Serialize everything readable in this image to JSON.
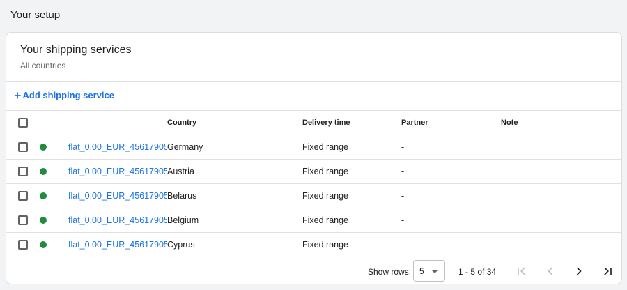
{
  "section": {
    "title": "Your setup"
  },
  "card": {
    "title": "Your shipping services",
    "subtitle": "All countries"
  },
  "actions": {
    "add_label": "Add shipping service",
    "add_icon": "plus-icon"
  },
  "table": {
    "columns": {
      "country": "Country",
      "delivery": "Delivery time",
      "partner": "Partner",
      "note": "Note"
    },
    "rows": [
      {
        "name": "flat_0.00_EUR_45617905",
        "country": "Germany",
        "delivery": "Fixed range",
        "partner": "-",
        "note": ""
      },
      {
        "name": "flat_0.00_EUR_45617905",
        "country": "Austria",
        "delivery": "Fixed range",
        "partner": "-",
        "note": ""
      },
      {
        "name": "flat_0.00_EUR_45617905",
        "country": "Belarus",
        "delivery": "Fixed range",
        "partner": "-",
        "note": ""
      },
      {
        "name": "flat_0.00_EUR_45617905",
        "country": "Belgium",
        "delivery": "Fixed range",
        "partner": "-",
        "note": ""
      },
      {
        "name": "flat_0.00_EUR_45617905",
        "country": "Cyprus",
        "delivery": "Fixed range",
        "partner": "-",
        "note": ""
      }
    ],
    "status_color": "#1e8e3e"
  },
  "pagination": {
    "show_rows_label": "Show rows:",
    "rows_value": "5",
    "range": "1 - 5 of 34"
  },
  "colors": {
    "accent": "#1a73e8",
    "background": "#f1f3f4"
  }
}
